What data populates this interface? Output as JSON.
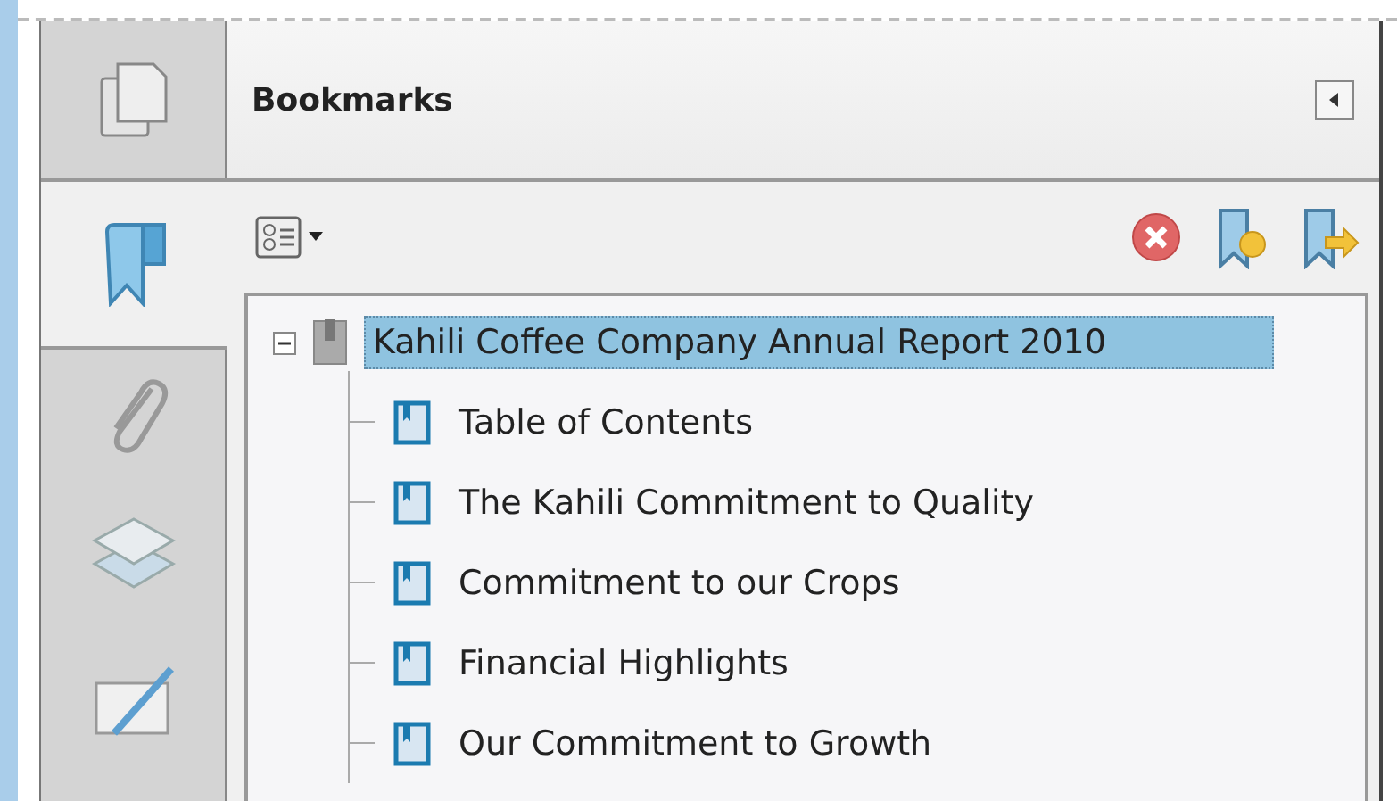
{
  "sidebar": {
    "tabs": [
      {
        "kind": "pages",
        "selected": false
      },
      {
        "kind": "bookmarks",
        "selected": true
      },
      {
        "kind": "attachments",
        "selected": false
      },
      {
        "kind": "layers",
        "selected": false
      },
      {
        "kind": "signatures",
        "selected": false
      }
    ]
  },
  "panel": {
    "title": "Bookmarks"
  },
  "tree": {
    "root": {
      "label": "Kahili Coffee Company Annual Report 2010",
      "expanded": true,
      "selected": true,
      "children": [
        {
          "label": "Table of Contents",
          "selected": false
        },
        {
          "label": "The Kahili Commitment to Quality",
          "selected": false
        },
        {
          "label": "Commitment to our Crops",
          "selected": false
        },
        {
          "label": "Financial Highlights",
          "selected": false
        },
        {
          "label": "Our Commitment to Growth",
          "selected": false
        }
      ]
    }
  }
}
